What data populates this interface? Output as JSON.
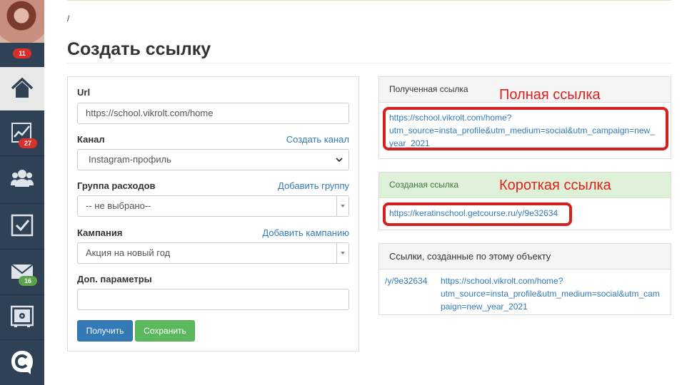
{
  "sidebar": {
    "avatar_badge": "11",
    "items": [
      {
        "icon": "home-icon",
        "badge": ""
      },
      {
        "icon": "chart-icon",
        "badge": "27",
        "badge_color": "#d9302b"
      },
      {
        "icon": "users-icon",
        "badge": ""
      },
      {
        "icon": "tasks-icon",
        "badge": ""
      },
      {
        "icon": "mail-icon",
        "badge": "16",
        "badge_color": "#5aa44c"
      },
      {
        "icon": "safe-icon",
        "badge": ""
      },
      {
        "icon": "getcourse-logo-icon",
        "badge": ""
      }
    ]
  },
  "breadcrumb": "/",
  "page_title": "Создать ссылку",
  "form": {
    "url_label": "Url",
    "url_value": "https://school.vikrolt.com/home",
    "channel_label": "Канал",
    "channel_link": "Создать канал",
    "channel_value": "Instagram-профиль",
    "expense_label": "Группа расходов",
    "expense_link": "Добавить группу",
    "expense_value": "-- не выбрано--",
    "campaign_label": "Кампания",
    "campaign_link": "Добавить кампанию",
    "campaign_value": "Акция на новый год",
    "params_label": "Доп. параметры",
    "params_value": "",
    "get_button": "Получить",
    "save_button": "Сохранить"
  },
  "result_panel": {
    "heading": "Полученная ссылка",
    "link_line1": "https://school.vikrolt.com/home?",
    "link_line2": "utm_source=insta_profile&utm_medium=social&utm_campaign=new_",
    "link_line3": "year_2021"
  },
  "short_panel": {
    "heading": "Созданая ссылка",
    "link": "https://keratinschool.getcourse.ru/y/9e32634"
  },
  "object_links_panel": {
    "heading": "Ссылки, созданные по этому объекту",
    "rows": [
      {
        "short": "/y/9e32634",
        "full_line1": "https://school.vikrolt.com/home?",
        "full_line2": "utm_source=insta_profile&utm_medium=social&utm_cam",
        "full_line3": "paign=new_year_2021"
      }
    ]
  },
  "annotations": {
    "full_link": "Полная ссылка",
    "short_link": "Короткая ссылка"
  },
  "colors": {
    "sidebar_bg": "#2f4154",
    "link": "#337ab7",
    "annotation_red": "#e0201b",
    "primary_button": "#337ab7",
    "success_button": "#5cb85c"
  }
}
